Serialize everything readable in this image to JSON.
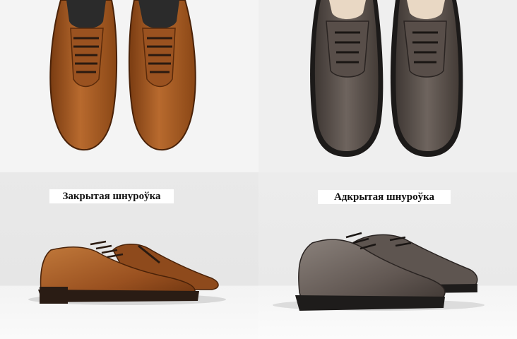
{
  "captions": {
    "closed_lacing": "Закрытая шнуроўка",
    "open_lacing": "Адкрытая шнуроўка"
  },
  "images": [
    {
      "name": "brown-oxford-top-view",
      "color": "#a55a24"
    },
    {
      "name": "grey-derby-top-view",
      "color": "#5b514c"
    },
    {
      "name": "brown-oxford-side-view",
      "color": "#a45a26"
    },
    {
      "name": "grey-derby-side-view",
      "color": "#6a605a"
    }
  ]
}
